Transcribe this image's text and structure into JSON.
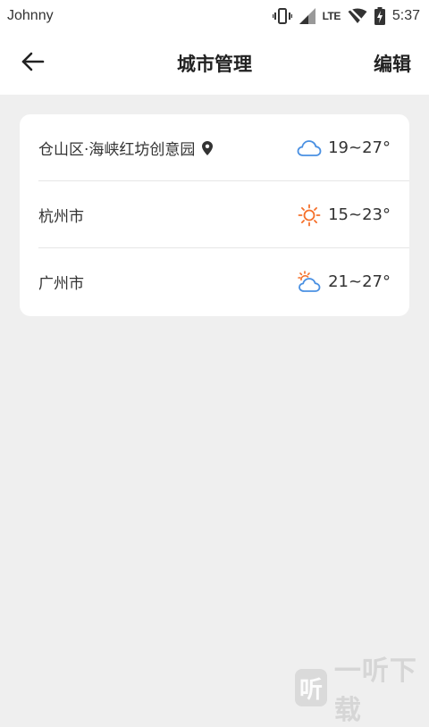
{
  "status_bar": {
    "carrier": "Johnny",
    "network": "LTE",
    "time": "5:37"
  },
  "app_bar": {
    "title": "城市管理",
    "edit_label": "编辑"
  },
  "cities": [
    {
      "name": "仓山区·海峡红坊创意园",
      "is_current_location": true,
      "weather": "cloudy",
      "temp": "19~27°"
    },
    {
      "name": "杭州市",
      "is_current_location": false,
      "weather": "sunny",
      "temp": "15~23°"
    },
    {
      "name": "广州市",
      "is_current_location": false,
      "weather": "partly-cloudy",
      "temp": "21~27°"
    }
  ],
  "colors": {
    "cloud": "#4a90e2",
    "sun": "#f5702a",
    "background": "#efefef"
  },
  "watermark": {
    "logo_char": "听",
    "text": "一听下载"
  }
}
